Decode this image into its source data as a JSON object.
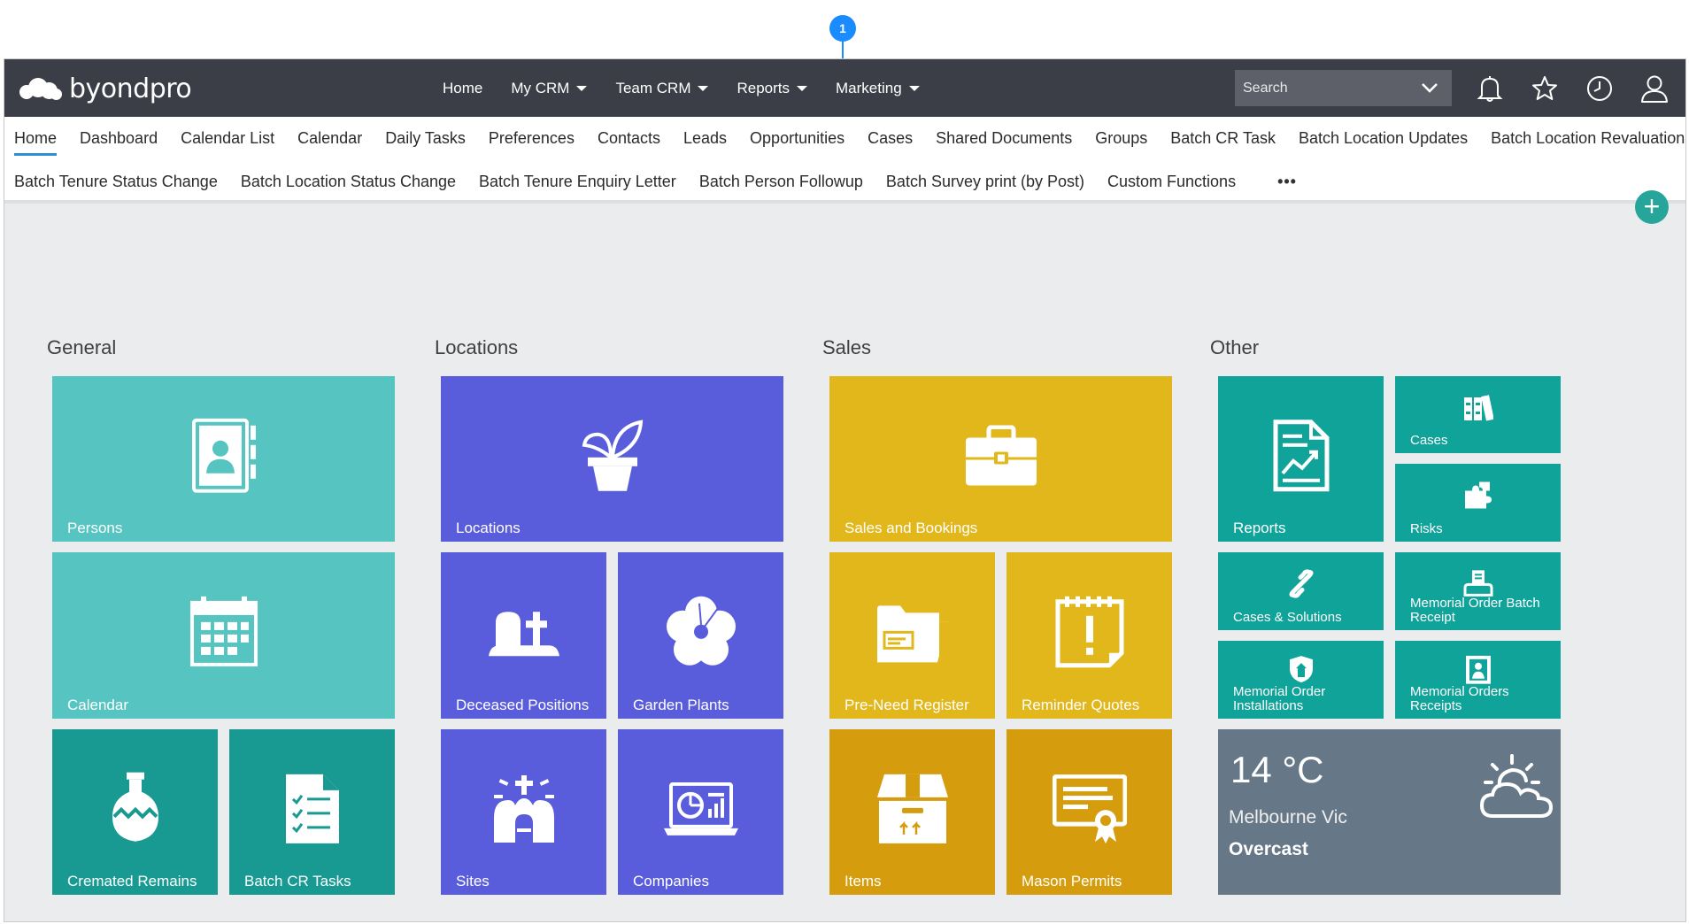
{
  "marker": {
    "number": "1"
  },
  "app": {
    "logo_text": "byondpro"
  },
  "main_nav": [
    {
      "label": "Home",
      "dropdown": false
    },
    {
      "label": "My CRM",
      "dropdown": true
    },
    {
      "label": "Team CRM",
      "dropdown": true
    },
    {
      "label": "Reports",
      "dropdown": true
    },
    {
      "label": "Marketing",
      "dropdown": true
    }
  ],
  "search": {
    "placeholder": "Search"
  },
  "top_icons": [
    "bell-icon",
    "star-icon",
    "clock-icon",
    "user-icon"
  ],
  "sub_nav": {
    "active": "Home",
    "row1": [
      "Home",
      "Dashboard",
      "Calendar List",
      "Calendar",
      "Daily Tasks",
      "Preferences",
      "Contacts",
      "Leads",
      "Opportunities",
      "Cases",
      "Shared Documents",
      "Groups",
      "Batch CR Task",
      "Batch Location Updates",
      "Batch Location Revaluation"
    ],
    "row2": [
      "Batch Tenure Status Change",
      "Batch Location Status Change",
      "Batch Tenure Enquiry Letter",
      "Batch Person Followup",
      "Batch Survey print (by Post)",
      "Custom Functions"
    ],
    "more": "•••",
    "add": "+"
  },
  "groups": {
    "general": {
      "title": "General",
      "tiles": {
        "persons": "Persons",
        "calendar": "Calendar",
        "cremated": "Cremated Remains",
        "batch_cr": "Batch CR Tasks"
      }
    },
    "locations": {
      "title": "Locations",
      "tiles": {
        "locations": "Locations",
        "deceased": "Deceased Positions",
        "garden": "Garden Plants",
        "sites": "Sites",
        "companies": "Companies"
      }
    },
    "sales": {
      "title": "Sales",
      "tiles": {
        "sales": "Sales and Bookings",
        "preneed": "Pre-Need Register",
        "reminder": "Reminder Quotes",
        "items": "Items",
        "mason": "Mason Permits"
      }
    },
    "other": {
      "title": "Other",
      "tiles": {
        "reports": "Reports",
        "cases": "Cases",
        "risks": "Risks",
        "cases_solutions": "Cases & Solutions",
        "mo_batch": "Memorial Order Batch Receipt",
        "mo_install": "Memorial Order Installations",
        "mo_receipts": "Memorial Orders Receipts"
      }
    }
  },
  "weather": {
    "temperature": "14 °C",
    "location": "Melbourne Vic",
    "condition": "Overcast",
    "icon": "partly-cloudy-icon"
  },
  "colors": {
    "teal": "#56c5c1",
    "dark_teal": "#189a93",
    "other_teal": "#0fa39a",
    "purple": "#5a5ddb",
    "yellow": "#e2b71c",
    "dark_yellow": "#d59d0e",
    "weather": "#667887",
    "topbar": "#3b3e47",
    "accent": "#26a69a"
  }
}
